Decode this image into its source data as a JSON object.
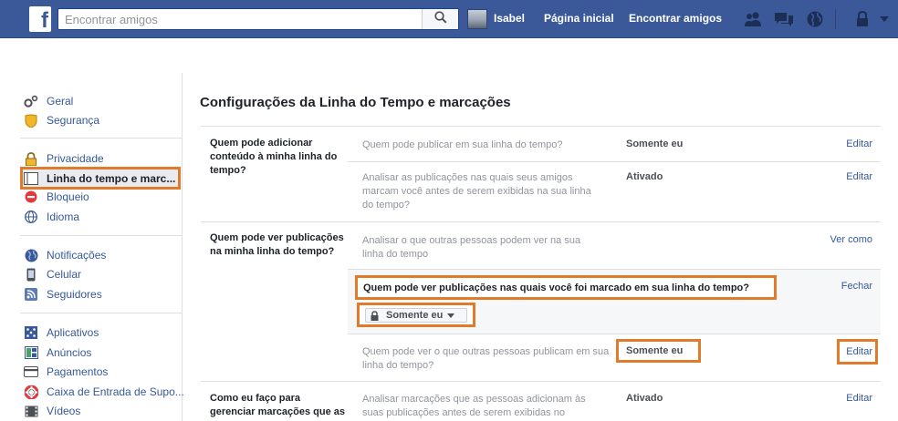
{
  "topbar": {
    "logo_letter": "f",
    "search_placeholder": "Encontrar amigos",
    "user_name": "Isabel",
    "nav_home": "Página inicial",
    "nav_find_friends": "Encontrar amigos",
    "icons": [
      "friend-requests-icon",
      "messages-icon",
      "notifications-globe-icon",
      "privacy-lock-icon",
      "dropdown-caret-icon"
    ],
    "brand_color": "#3b5998"
  },
  "sidebar": {
    "groups": [
      [
        {
          "label": "Geral",
          "icon": "gear-icon"
        },
        {
          "label": "Segurança",
          "icon": "shield-icon"
        }
      ],
      [
        {
          "label": "Privacidade",
          "icon": "lock-icon"
        },
        {
          "label": "Linha do tempo e marc...",
          "icon": "timeline-icon",
          "active": true
        },
        {
          "label": "Bloqueio",
          "icon": "block-icon"
        },
        {
          "label": "Idioma",
          "icon": "language-icon"
        }
      ],
      [
        {
          "label": "Notificações",
          "icon": "globe-icon"
        },
        {
          "label": "Celular",
          "icon": "mobile-icon"
        },
        {
          "label": "Seguidores",
          "icon": "rss-icon"
        }
      ],
      [
        {
          "label": "Aplicativos",
          "icon": "apps-icon"
        },
        {
          "label": "Anúncios",
          "icon": "ads-icon"
        },
        {
          "label": "Pagamentos",
          "icon": "card-icon"
        },
        {
          "label": "Caixa de Entrada de Supo...",
          "icon": "lifebuoy-icon"
        },
        {
          "label": "Vídeos",
          "icon": "video-icon"
        }
      ]
    ]
  },
  "main": {
    "title": "Configurações da Linha do Tempo e marcações",
    "sections": [
      {
        "label": "Quem pode adicionar conteúdo à minha linha do tempo?",
        "rows": [
          {
            "desc": "Quem pode publicar em sua linha do tempo?",
            "value": "Somente eu",
            "link": "Editar"
          },
          {
            "desc": "Analisar as publicações nas quais seus amigos marcam você antes de serem exibidas na sua linha do tempo?",
            "value": "Ativado",
            "link": "Editar"
          }
        ]
      },
      {
        "label": "Quem pode ver publicações na minha linha do tempo?",
        "rows": [
          {
            "desc": "Analisar o que outras pessoas podem ver na sua linha do tempo",
            "value": "",
            "link": "Ver como"
          },
          {
            "desc": "Quem pode ver publicações nas quais você foi marcado em sua linha do tempo?",
            "value": "Somente eu",
            "link": "Fechar",
            "expanded": true
          },
          {
            "desc": "Quem pode ver o que outras pessoas publicam em sua linha do tempo?",
            "value": "Somente eu",
            "link": "Editar"
          }
        ]
      },
      {
        "label": "Como eu faço para gerenciar marcações que as pessoas",
        "rows": [
          {
            "desc": "Analisar marcações que as pessoas adicionam às suas publicações antes de serem exibidas no",
            "value": "Ativado",
            "link": "Editar"
          }
        ]
      }
    ],
    "highlight_color": "#e07b2c"
  }
}
